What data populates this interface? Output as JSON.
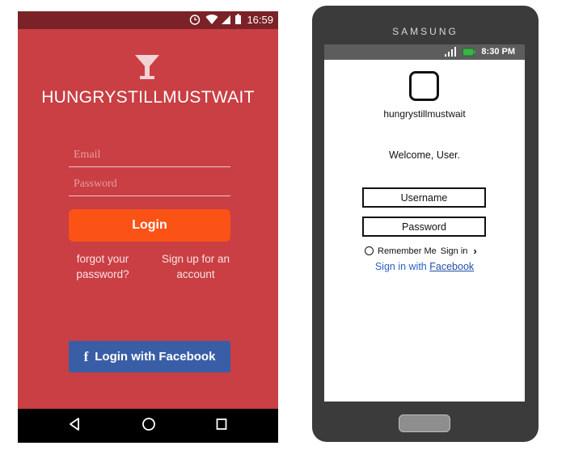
{
  "android": {
    "status": {
      "time": "16:59"
    },
    "app_title": "HUNGRYSTILLMUSTWAIT",
    "email_placeholder": "Email",
    "password_placeholder": "Password",
    "login_label": "Login",
    "forgot_line1": "forgot your",
    "forgot_line2": "password?",
    "signup_line1": "Sign up for an",
    "signup_line2": "account",
    "facebook_glyph": "f",
    "facebook_label": "Login with Facebook",
    "colors": {
      "background": "#c93f44",
      "status_bar": "#7a2227",
      "login_button": "#fb5316",
      "facebook_button": "#3a5ea6"
    }
  },
  "samsung": {
    "brand": "SAMSUNG",
    "status": {
      "time": "8:30 PM"
    },
    "app_name": "hungrystillmustwait",
    "welcome": "Welcome, User.",
    "username_placeholder": "Username",
    "password_placeholder": "Password",
    "remember_label": "Remember Me",
    "signin_label": "Sign in",
    "facebook_prefix": "Sign in with",
    "facebook_link": "Facebook",
    "colors": {
      "body": "#3b3b3b",
      "link": "#2a62c4"
    }
  }
}
